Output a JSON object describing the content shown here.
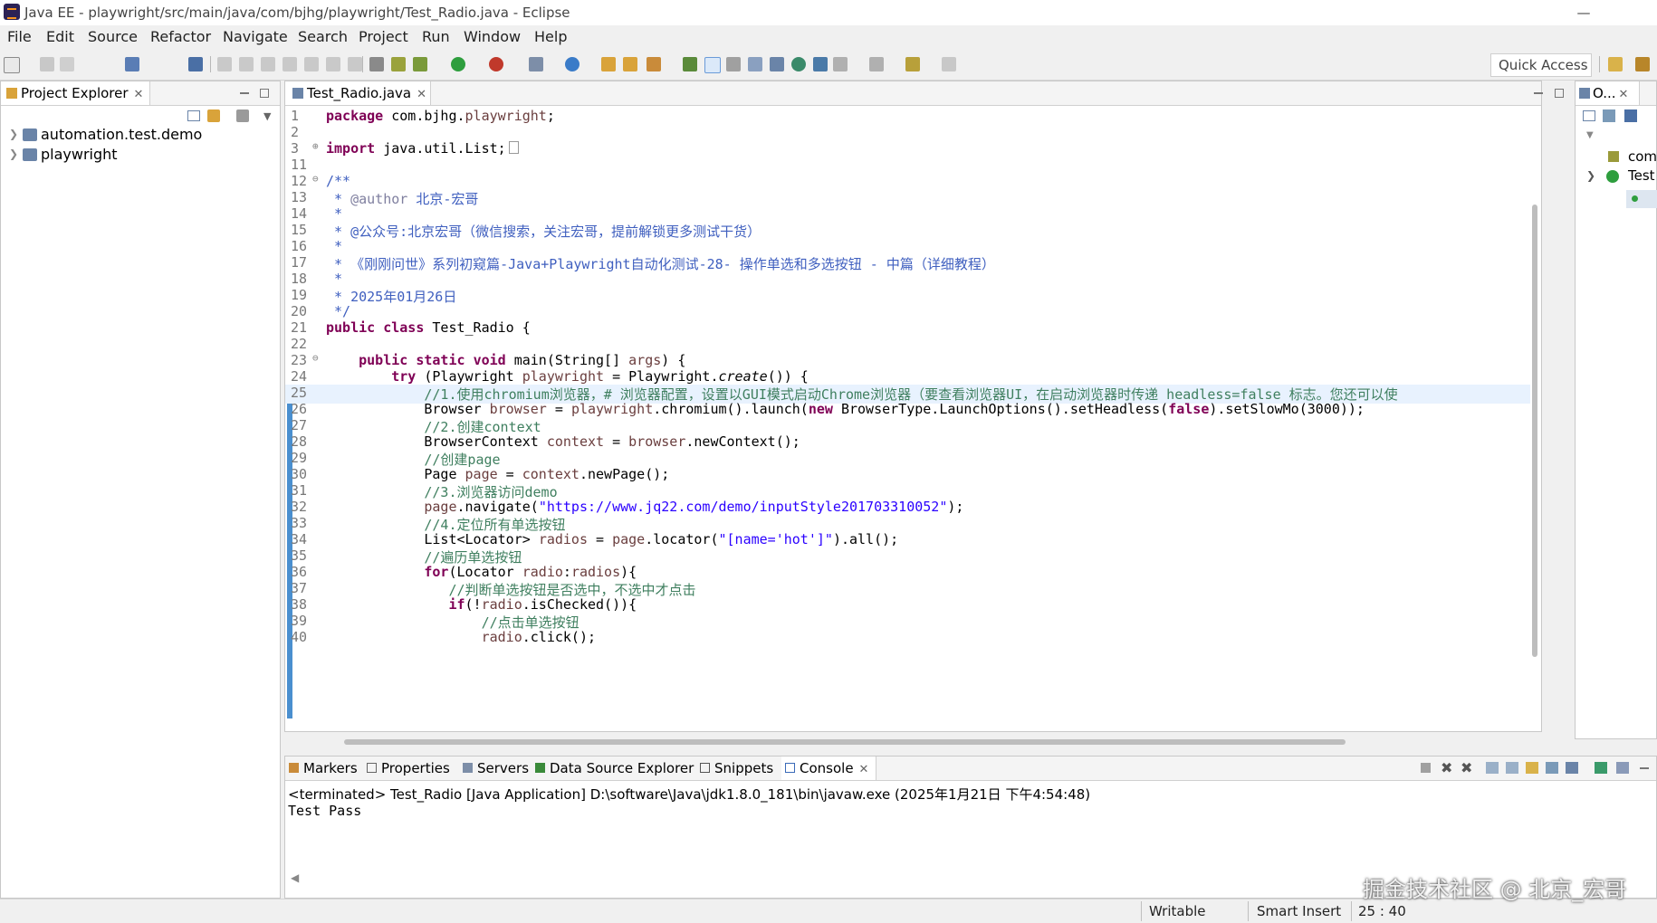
{
  "window": {
    "title": "Java EE - playwright/src/main/java/com/bjhg/playwright/Test_Radio.java - Eclipse"
  },
  "menu": [
    "File",
    "Edit",
    "Source",
    "Refactor",
    "Navigate",
    "Search",
    "Project",
    "Run",
    "Window",
    "Help"
  ],
  "toolbar": {
    "quick_access": "Quick Access"
  },
  "explorer": {
    "tab_label": "Project Explorer",
    "projects": [
      "automation.test.demo",
      "playwright"
    ]
  },
  "editor": {
    "tab_label": "Test_Radio.java",
    "lines": [
      {
        "n": "1",
        "code": "package com.bjhg.playwright;"
      },
      {
        "n": "2",
        "code": ""
      },
      {
        "n": "3",
        "code": "import java.util.List;"
      },
      {
        "n": "11",
        "code": ""
      },
      {
        "n": "12",
        "code": "/**"
      },
      {
        "n": "13",
        "code": " * @author 北京-宏哥"
      },
      {
        "n": "14",
        "code": " *"
      },
      {
        "n": "15",
        "code": " * @公众号:北京宏哥（微信搜索，关注宏哥，提前解锁更多测试干货）"
      },
      {
        "n": "16",
        "code": " *"
      },
      {
        "n": "17",
        "code": " * 《刚刚问世》系列初窥篇-Java+Playwright自动化测试-28- 操作单选和多选按钮 - 中篇（详细教程）"
      },
      {
        "n": "18",
        "code": " *"
      },
      {
        "n": "19",
        "code": " * 2025年01月26日"
      },
      {
        "n": "20",
        "code": " */"
      },
      {
        "n": "21",
        "code": "public class Test_Radio {"
      },
      {
        "n": "22",
        "code": ""
      },
      {
        "n": "23",
        "code": "    public static void main(String[] args) {"
      },
      {
        "n": "24",
        "code": "        try (Playwright playwright = Playwright.create()) {"
      },
      {
        "n": "25",
        "code": "            //1.使用chromium浏览器，# 浏览器配置，设置以GUI模式启动Chrome浏览器（要查看浏览器UI，在启动浏览器时传递 headless=false 标志。您还可以使"
      },
      {
        "n": "26",
        "code": "            Browser browser = playwright.chromium().launch(new BrowserType.LaunchOptions().setHeadless(false).setSlowMo(3000));"
      },
      {
        "n": "27",
        "code": "            //2.创建context"
      },
      {
        "n": "28",
        "code": "            BrowserContext context = browser.newContext();"
      },
      {
        "n": "29",
        "code": "            //创建page"
      },
      {
        "n": "30",
        "code": "            Page page = context.newPage();"
      },
      {
        "n": "31",
        "code": "            //3.浏览器访问demo"
      },
      {
        "n": "32",
        "code": "            page.navigate(\"https://www.jq22.com/demo/inputStyle201703310052\");"
      },
      {
        "n": "33",
        "code": "            //4.定位所有单选按钮"
      },
      {
        "n": "34",
        "code": "            List<Locator> radios = page.locator(\"[name='hot']\").all();"
      },
      {
        "n": "35",
        "code": "            //遍历单选按钮"
      },
      {
        "n": "36",
        "code": "            for(Locator radio:radios){"
      },
      {
        "n": "37",
        "code": "               //判断单选按钮是否选中，不选中才点击"
      },
      {
        "n": "38",
        "code": "               if(!radio.isChecked()){"
      },
      {
        "n": "39",
        "code": "                   //点击单选按钮"
      },
      {
        "n": "40",
        "code": "                   radio.click();"
      }
    ]
  },
  "outline": {
    "tab_label": "O...",
    "items": [
      "com",
      "Test"
    ]
  },
  "bottom_tabs": [
    "Markers",
    "Properties",
    "Servers",
    "Data Source Explorer",
    "Snippets",
    "Console"
  ],
  "console": {
    "header": "<terminated> Test_Radio [Java Application] D:\\software\\Java\\jdk1.8.0_181\\bin\\javaw.exe (2025年1月21日 下午4:54:48)",
    "output": "Test Pass"
  },
  "status": {
    "writable": "Writable",
    "insert_mode": "Smart Insert",
    "position": "25 : 40"
  },
  "watermark": "掘金技术社区 @ 北京_宏哥",
  "colors": {
    "keyword": "#7f0055",
    "comment": "#3f7f5f",
    "javadoc": "#3f5fbf",
    "string": "#2a00ff",
    "field": "#6a3e3e"
  }
}
